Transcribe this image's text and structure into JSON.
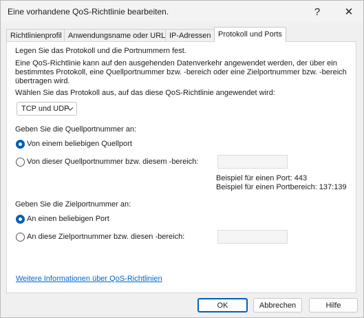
{
  "window": {
    "title": "Eine vorhandene QoS-Richtlinie bearbeiten.",
    "help_glyph": "?",
    "close_glyph": "✕"
  },
  "tabs": [
    {
      "label": "Richtlinienprofil",
      "active": false
    },
    {
      "label": "Anwendungsname oder URL",
      "active": false
    },
    {
      "label": "IP-Adressen",
      "active": false
    },
    {
      "label": "Protokoll und Ports",
      "active": true
    }
  ],
  "panel": {
    "heading": "Legen Sie das Protokoll und die Portnummern fest.",
    "description": "Eine QoS-Richtlinie kann auf den ausgehenden Datenverkehr angewendet werden, der über ein bestimmtes Protokoll, eine Quellportnummer bzw. -bereich oder eine Zielportnummer bzw. -bereich übertragen wird.",
    "protocol_prompt": "Wählen Sie das Protokoll aus, auf das diese QoS-Richtlinie angewendet wird:",
    "protocol_select": {
      "value": "TCP und UDP"
    },
    "source": {
      "prompt": "Geben Sie die Quellportnummer an:",
      "option_any": "Von einem beliebigen Quellport",
      "option_specific": "Von dieser Quellportnummer bzw. diesem -bereich:",
      "selected": "any",
      "field_value": ""
    },
    "examples": {
      "port": "Beispiel für einen Port: 443",
      "range": "Beispiel für einen Portbereich: 137:139"
    },
    "destination": {
      "prompt": "Geben Sie die Zielportnummer an:",
      "option_any": "An einen beliebigen Port",
      "option_specific": "An diese Zielportnummer bzw. diesen -bereich:",
      "selected": "any",
      "field_value": ""
    },
    "info_link": "Weitere Informationen über QoS-Richtlinien"
  },
  "buttons": {
    "ok": "OK",
    "cancel": "Abbrechen",
    "help": "Hilfe"
  },
  "colors": {
    "accent": "#005fb8",
    "link": "#0066cc"
  }
}
